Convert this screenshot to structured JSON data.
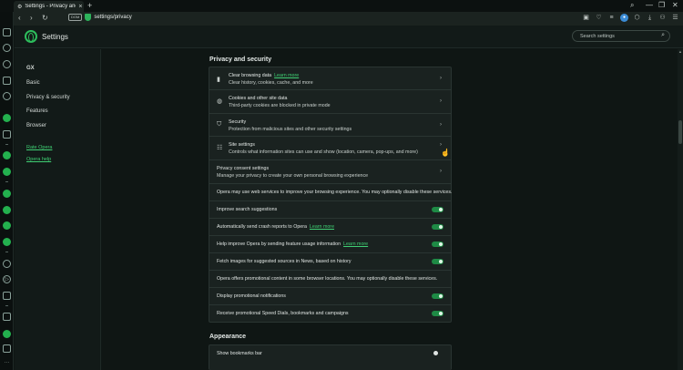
{
  "window": {
    "tab_title": "Settings - Privacy and security",
    "url": "settings/privacy",
    "address_badge": "DOM"
  },
  "settings_header": {
    "title": "Settings",
    "search_placeholder": "Search settings"
  },
  "nav": {
    "group_title": "GX",
    "items": [
      "Basic",
      "Privacy & security",
      "Features",
      "Browser"
    ],
    "links": [
      "Rate Opera",
      "Opera help"
    ]
  },
  "privacy": {
    "section_title": "Privacy and security",
    "link_rows": [
      {
        "title": "Clear browsing data",
        "link": "Learn more",
        "subtitle": "Clear history, cookies, cache, and more",
        "icon": "trash-icon"
      },
      {
        "title": "Cookies and other site data",
        "subtitle": "Third-party cookies are blocked in private mode",
        "icon": "cookie-icon"
      },
      {
        "title": "Security",
        "subtitle": "Protection from malicious sites and other security settings",
        "icon": "shield-icon"
      },
      {
        "title": "Site settings",
        "subtitle": "Controls what information sites can use and show (location, camera, pop-ups, and more)",
        "icon": "sliders-icon"
      },
      {
        "title": "Privacy consent settings",
        "subtitle": "Manage your privacy to create your own personal browsing experience",
        "icon": ""
      }
    ],
    "web_services_note": "Opera may use web services to improve your browsing experience. You may optionally disable these services.",
    "toggles": [
      {
        "label": "Improve search suggestions",
        "link": "",
        "on": true
      },
      {
        "label": "Automatically send crash reports to Opera",
        "link": "Learn more",
        "on": true
      },
      {
        "label": "Help improve Opera by sending feature usage information",
        "link": "Learn more",
        "on": true
      },
      {
        "label": "Fetch images for suggested sources in News, based on history",
        "link": "",
        "on": true
      }
    ],
    "promo_note": "Opera offers promotional content in some browser locations. You may optionally disable these services.",
    "promo_toggles": [
      {
        "label": "Display promotional notifications",
        "on": true
      },
      {
        "label": "Receive promotional Speed Dials, bookmarks and campaigns",
        "on": true
      }
    ]
  },
  "appearance": {
    "section_title": "Appearance",
    "rows": [
      {
        "label": "Show bookmarks bar",
        "on": false
      }
    ]
  },
  "colors": {
    "accent": "#2dbd5c",
    "background": "#0f1614",
    "card": "#1a2220"
  }
}
